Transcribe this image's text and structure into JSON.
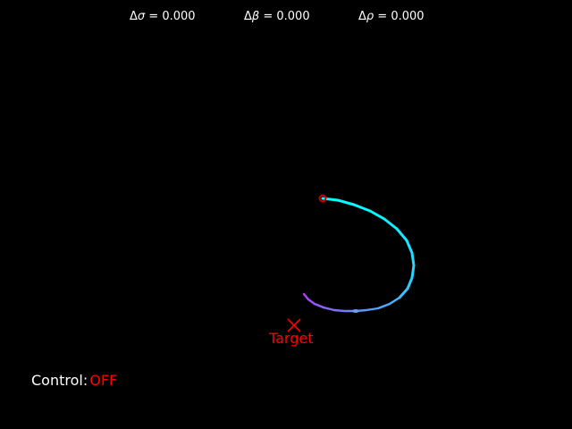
{
  "readouts": [
    {
      "delta": "Δ",
      "symbol": "σ",
      "equals": " = ",
      "value": "0.000"
    },
    {
      "delta": "Δ",
      "symbol": "β",
      "equals": " = ",
      "value": "0.000"
    },
    {
      "delta": "Δ",
      "symbol": "ρ",
      "equals": " = ",
      "value": "0.000"
    }
  ],
  "target": {
    "label": "Target",
    "color": "#ff0000"
  },
  "control": {
    "label": "Control:",
    "value": "OFF",
    "value_color": "#ff0000"
  },
  "trajectory": {
    "start_marker_color": "#cc0000",
    "colormap": "cool",
    "start_color": "#00ffff",
    "end_color": "#b040ff"
  },
  "colors": {
    "background": "#000000",
    "text": "#ffffff"
  }
}
